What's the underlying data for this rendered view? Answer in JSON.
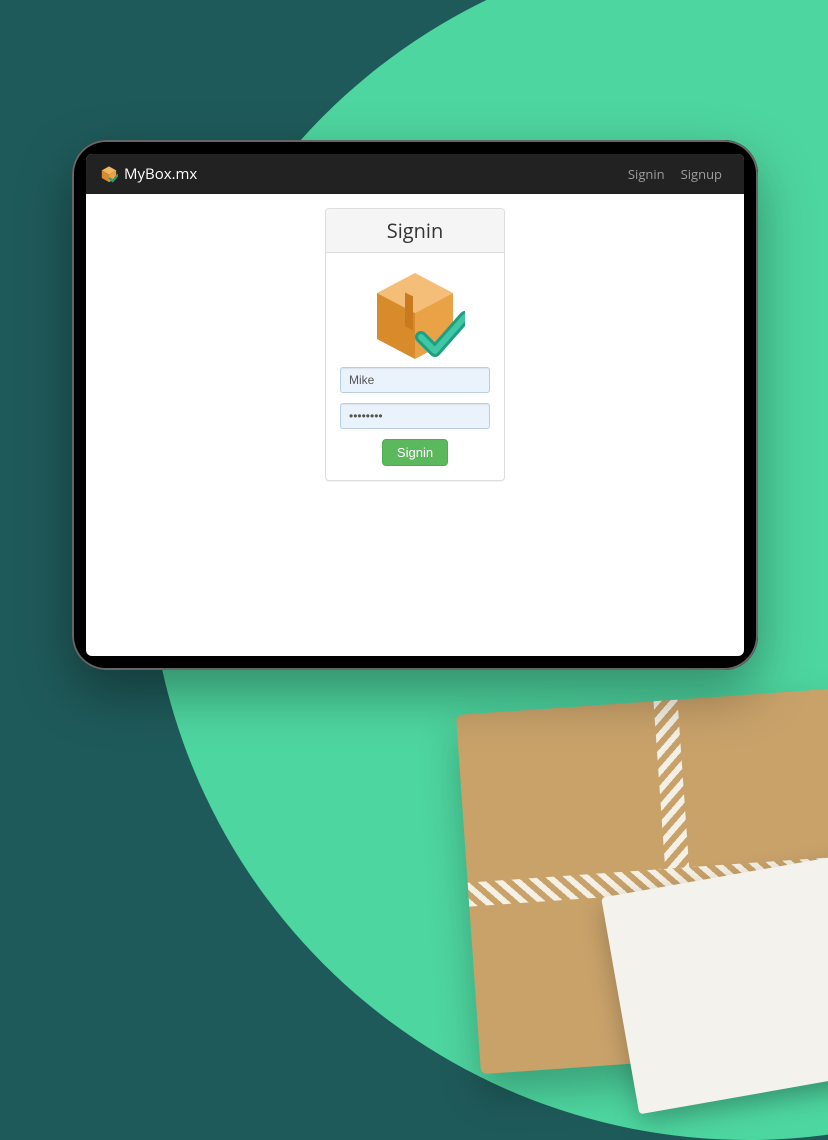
{
  "brand": {
    "name": "MyBox.mx"
  },
  "nav": {
    "signin": "Signin",
    "signup": "Signup"
  },
  "panel": {
    "title": "Signin",
    "username_value": "Mike",
    "password_value": "••••••••",
    "submit_label": "Signin"
  }
}
